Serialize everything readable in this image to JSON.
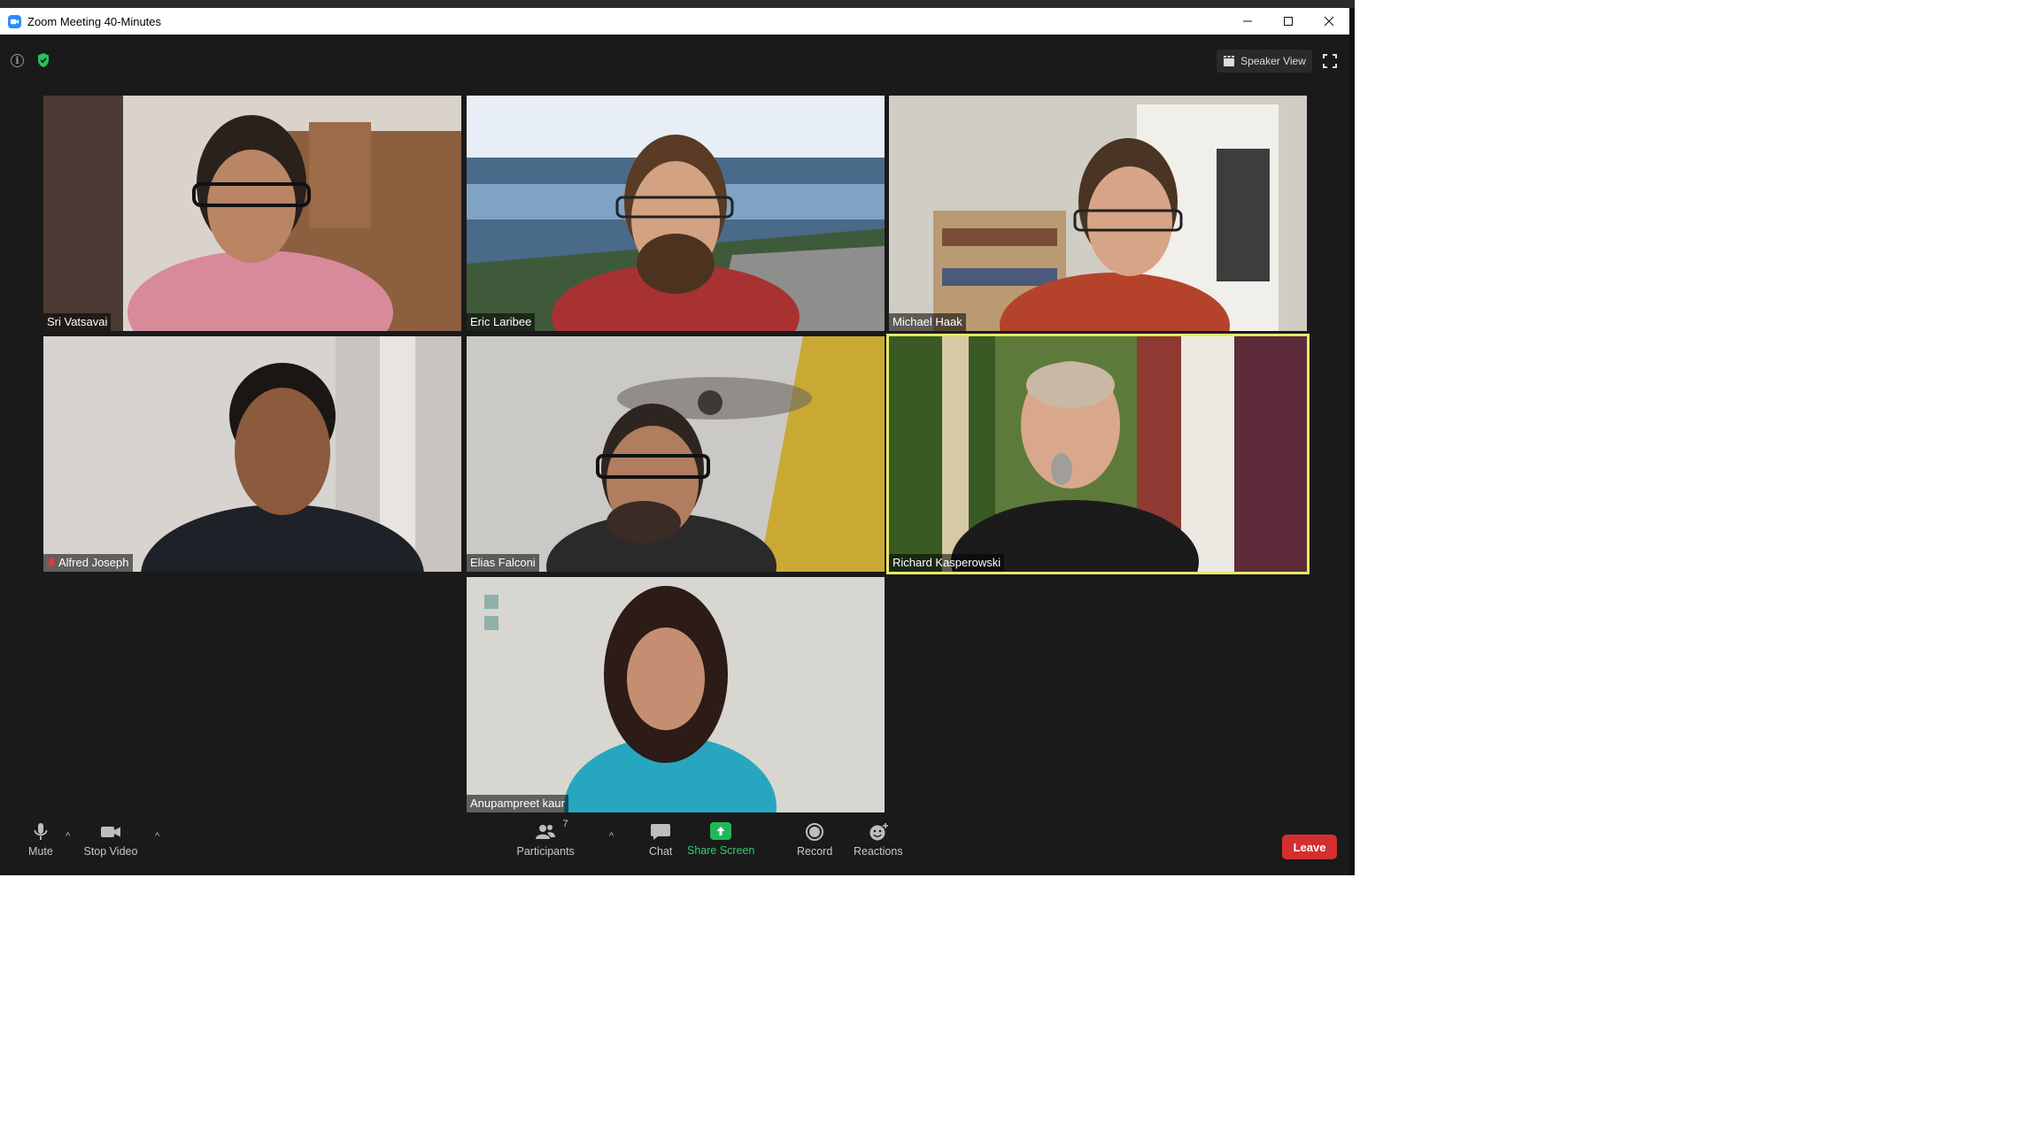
{
  "window": {
    "title": "Zoom Meeting 40-Minutes"
  },
  "header": {
    "speaker_view_label": "Speaker View"
  },
  "participants": [
    {
      "name": "Sri Vatsavai",
      "muted": false,
      "active": false
    },
    {
      "name": "Eric Laribee",
      "muted": false,
      "active": false
    },
    {
      "name": "Michael Haak",
      "muted": false,
      "active": false
    },
    {
      "name": "Alfred Joseph",
      "muted": true,
      "active": false
    },
    {
      "name": "Elias Falconi",
      "muted": false,
      "active": false
    },
    {
      "name": "Richard Kasperowski",
      "muted": false,
      "active": true
    },
    {
      "name": "Anupampreet kaur",
      "muted": false,
      "active": false
    }
  ],
  "toolbar": {
    "mute_label": "Mute",
    "stop_video_label": "Stop Video",
    "participants_label": "Participants",
    "participants_count": "7",
    "chat_label": "Chat",
    "share_screen_label": "Share Screen",
    "record_label": "Record",
    "reactions_label": "Reactions",
    "leave_label": "Leave"
  },
  "colors": {
    "active_speaker_border": "#e6e86a",
    "share_screen": "#20b957",
    "leave": "#d32f2f",
    "zoom_blue": "#2d8cff"
  }
}
